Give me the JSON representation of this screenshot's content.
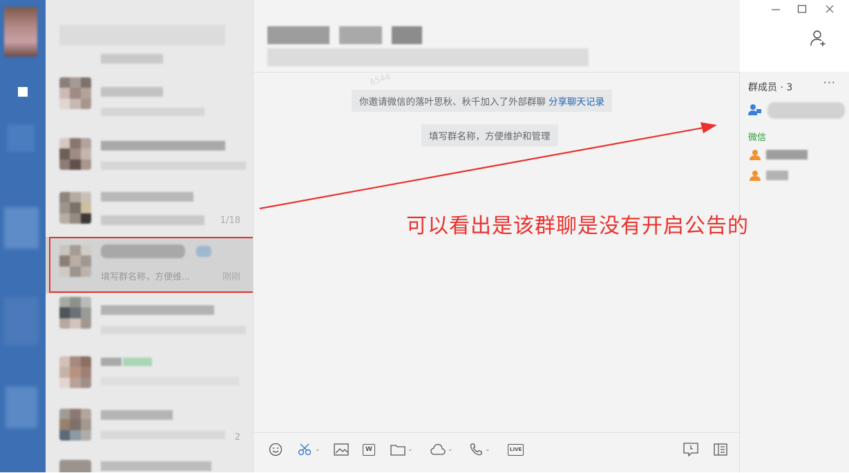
{
  "chat_list": {
    "items": [
      {
        "preview": "",
        "time": ""
      },
      {
        "preview": "",
        "time": ""
      },
      {
        "preview": "",
        "time": ""
      },
      {
        "preview": "",
        "time": "1/18"
      },
      {
        "preview": "填写群名称，方便维...",
        "time": "刚刚"
      },
      {
        "preview": "",
        "time": ""
      },
      {
        "preview": "",
        "time": ""
      },
      {
        "preview": "",
        "time": "2"
      }
    ]
  },
  "chat": {
    "messages": [
      {
        "text": "你邀请微信的落叶思秋、秋千加入了外部群聊",
        "link": "分享聊天记录"
      },
      {
        "text": "填写群名称，方便维护和管理"
      }
    ],
    "watermark": "6544"
  },
  "members": {
    "title": "群成员 · 3",
    "more": "···",
    "section_label": "微信"
  },
  "toolbar": {
    "word_icon_text": "W",
    "live_icon_text": "LIVE"
  },
  "annotation": {
    "text": "可以看出是该群聊是没有开启公告的"
  },
  "colors": {
    "annotation": "#e8322d",
    "link": "#2764b0",
    "wechat_green": "#2e9e3e",
    "member_orange": "#f0922f",
    "member_blue": "#3b7fd6"
  }
}
